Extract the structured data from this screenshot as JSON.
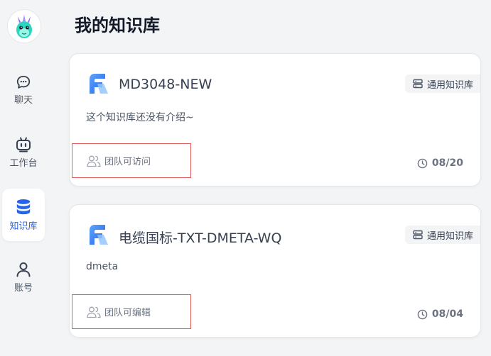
{
  "sidebar": {
    "items": [
      {
        "label": "聊天",
        "icon": "chat-icon",
        "active": false
      },
      {
        "label": "工作台",
        "icon": "robot-icon",
        "active": false
      },
      {
        "label": "知识库",
        "icon": "database-icon",
        "active": true
      },
      {
        "label": "账号",
        "icon": "user-icon",
        "active": false
      }
    ]
  },
  "page": {
    "title": "我的知识库"
  },
  "colors": {
    "accent": "#2563eb",
    "highlight_border": "#e05a5a",
    "background": "#f3f4f6"
  },
  "knowledge_bases": [
    {
      "name": "MD3048-NEW",
      "type": "通用知识库",
      "intro": "这个知识库还没有介绍~",
      "permission": "团队可访问",
      "date": "08/20"
    },
    {
      "name": "电缆国标-TXT-DMETA-WQ",
      "type": "通用知识库",
      "intro": "dmeta",
      "permission": "团队可编辑",
      "date": "08/04"
    }
  ]
}
